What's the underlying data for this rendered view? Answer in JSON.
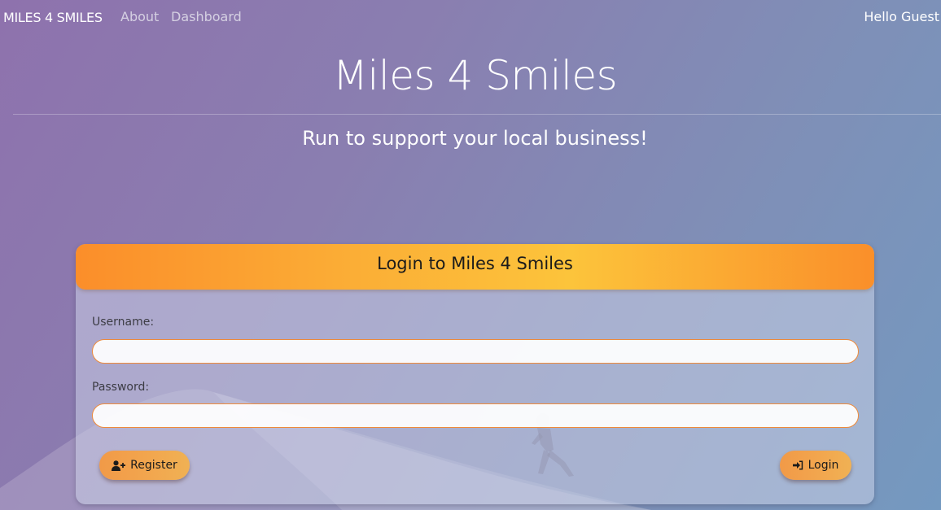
{
  "navbar": {
    "brand": "MILES 4 SMILES",
    "links": [
      {
        "label": "About"
      },
      {
        "label": "Dashboard"
      }
    ],
    "greeting": "Hello Guest"
  },
  "hero": {
    "title": "Miles 4 Smiles",
    "subtitle": "Run to support your local business!"
  },
  "login_card": {
    "title": "Login to Miles 4 Smiles",
    "username": {
      "label": "Username:",
      "value": "",
      "placeholder": ""
    },
    "password": {
      "label": "Password:",
      "value": "",
      "placeholder": ""
    },
    "register_button": {
      "label": "Register",
      "icon": "user-plus-icon"
    },
    "login_button": {
      "label": "Login",
      "icon": "sign-in-icon"
    }
  },
  "colors": {
    "accent_orange": "#fb8e2a",
    "accent_yellow": "#fcc43b",
    "input_border": "#ef8a3a",
    "background_purple": "#8e72ad",
    "background_blue": "#7499c0"
  }
}
